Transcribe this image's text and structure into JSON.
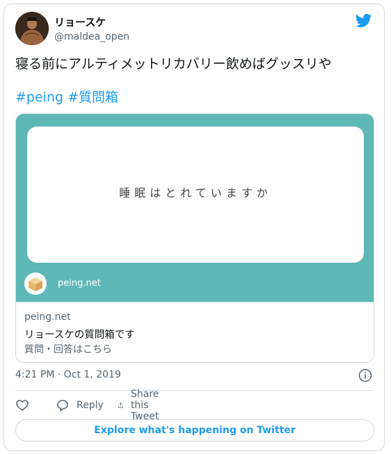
{
  "user": {
    "name": "リョースケ",
    "handle": "@maldea_open"
  },
  "tweet": {
    "text": "寝る前にアルティメットリカバリー飲めばグッスリや",
    "hashtags": [
      "#peing",
      "#質問箱"
    ]
  },
  "card": {
    "question": "睡眠はとれていますか",
    "image_host": "peing.net",
    "meta_host": "peing.net",
    "title": "リョースケの質問箱です",
    "description": "質問・回答はこちら",
    "image_bg_color": "#5fb8b8"
  },
  "timestamp": "4:21 PM · Oct 1, 2019",
  "actions": {
    "like_label": "",
    "reply_label": "Reply",
    "share_label": "Share this Tweet"
  },
  "explore_label": "Explore what's happening on Twitter",
  "colors": {
    "accent": "#1d9bf0",
    "secondary_text": "#536471",
    "border": "#cfd9de"
  }
}
